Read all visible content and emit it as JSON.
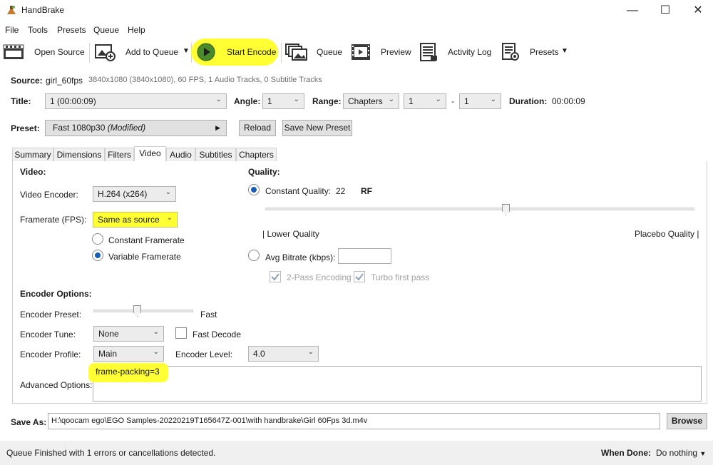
{
  "window": {
    "title": "HandBrake",
    "minimize": "—",
    "maximize": "☐",
    "close": "✕"
  },
  "menu": [
    {
      "label": "File"
    },
    {
      "label": "Tools"
    },
    {
      "label": "Presets"
    },
    {
      "label": "Queue"
    },
    {
      "label": "Help"
    }
  ],
  "toolbar": {
    "open_source": "Open Source",
    "add_to_queue": "Add to Queue",
    "start_encode": "Start Encode",
    "queue": "Queue",
    "preview": "Preview",
    "activity_log": "Activity Log",
    "presets": "Presets"
  },
  "source": {
    "label": "Source:",
    "name": "girl_60fps",
    "info": "3840x1080 (3840x1080), 60 FPS, 1 Audio Tracks, 0 Subtitle Tracks"
  },
  "title_row": {
    "title_label": "Title:",
    "title_value": "1  (00:00:09)",
    "angle_label": "Angle:",
    "angle_value": "1",
    "range_label": "Range:",
    "range_value": "Chapters",
    "range_start": "1",
    "range_dash": "-",
    "range_end": "1",
    "duration_label": "Duration:",
    "duration_value": "00:00:09"
  },
  "preset": {
    "label": "Preset:",
    "value": "Fast 1080p30",
    "modified": "(Modified)",
    "reload": "Reload",
    "save_new": "Save New Preset"
  },
  "tabs": [
    {
      "label": "Summary"
    },
    {
      "label": "Dimensions"
    },
    {
      "label": "Filters"
    },
    {
      "label": "Video"
    },
    {
      "label": "Audio"
    },
    {
      "label": "Subtitles"
    },
    {
      "label": "Chapters"
    }
  ],
  "video": {
    "heading": "Video:",
    "encoder_label": "Video Encoder:",
    "encoder_value": "H.264 (x264)",
    "framerate_label": "Framerate (FPS):",
    "framerate_value": "Same as source",
    "constant_fr": "Constant Framerate",
    "variable_fr": "Variable Framerate"
  },
  "quality": {
    "heading": "Quality:",
    "cq_label": "Constant Quality:",
    "cq_value": "22",
    "rf": "RF",
    "rf_slider_fraction": 0.56,
    "lower": "| Lower Quality",
    "placebo": "Placebo Quality |",
    "avg_label": "Avg Bitrate (kbps):",
    "two_pass": "2-Pass Encoding",
    "turbo": "Turbo first pass"
  },
  "encoder_options": {
    "heading": "Encoder Options:",
    "preset_label": "Encoder Preset:",
    "preset_value": "Fast",
    "tune_label": "Encoder Tune:",
    "tune_value": "None",
    "fast_decode": "Fast Decode",
    "profile_label": "Encoder Profile:",
    "profile_value": "Main",
    "level_label": "Encoder Level:",
    "level_value": "4.0",
    "advanced_label": "Advanced Options:",
    "advanced_value": "frame-packing=3"
  },
  "save_as": {
    "label": "Save As:",
    "path": "H:\\qoocam ego\\EGO Samples-20220219T165647Z-001\\with handbrake\\Girl 60Fps 3d.m4v",
    "browse": "Browse"
  },
  "status": {
    "message": "Queue Finished with 1 errors or cancellations detected.",
    "when_done_label": "When Done:",
    "when_done_value": "Do nothing"
  },
  "colors": {
    "highlight": "#ffff33",
    "radio_selected": "#1a5fb4"
  }
}
